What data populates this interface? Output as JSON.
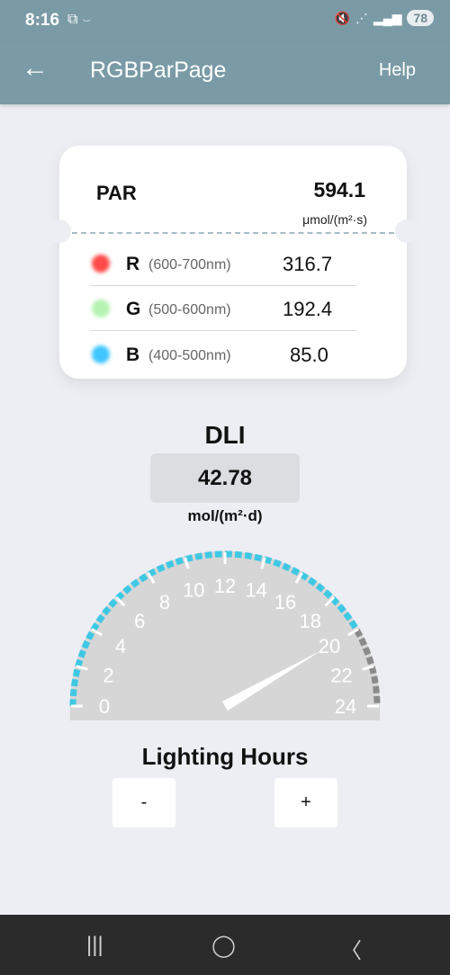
{
  "status_bar": {
    "time": "8:16",
    "left_icons": "screenshot-icon, link-icon",
    "battery": "78"
  },
  "app_bar": {
    "title": "RGBParPage",
    "help_label": "Help"
  },
  "par_card": {
    "label": "PAR",
    "value": "594.1",
    "unit": "μmol/(m²·s)",
    "rows": [
      {
        "letter": "R",
        "range": "(600-700nm)",
        "value": "316.7",
        "color": "#ff4a4a"
      },
      {
        "letter": "G",
        "range": "(500-600nm)",
        "value": "192.4",
        "color": "#b5f3b0"
      },
      {
        "letter": "B",
        "range": "(400-500nm)",
        "value": "85.0",
        "color": "#3fc6ff"
      }
    ]
  },
  "dli": {
    "title": "DLI",
    "value": "42.78",
    "unit": "mol/(m²·d)"
  },
  "gauge": {
    "min": 0,
    "max": 24,
    "value": 20,
    "tick_labels": [
      "0",
      "2",
      "4",
      "6",
      "8",
      "10",
      "12",
      "14",
      "16",
      "18",
      "20",
      "22",
      "24"
    ],
    "active_color": "#3fc8e4",
    "inactive_color": "#8a8a8a",
    "face_color": "#d6d6d6"
  },
  "lighting": {
    "title": "Lighting Hours",
    "minus_label": "-",
    "plus_label": "+"
  },
  "colors": {
    "app_bar": "#7a9ba6",
    "background": "#eceef3"
  }
}
